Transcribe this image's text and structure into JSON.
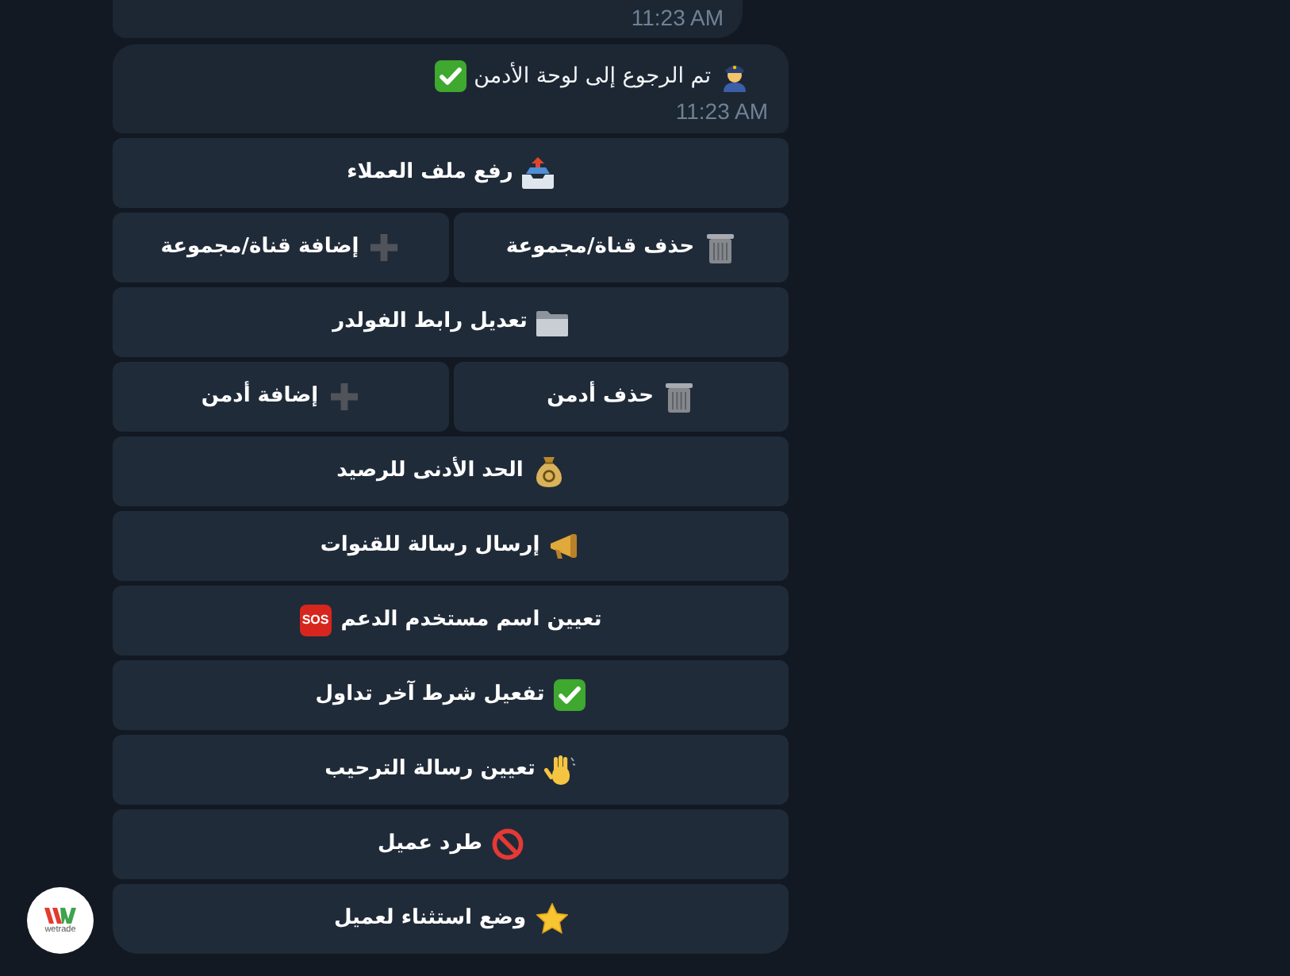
{
  "messages": [
    {
      "time": "11:23 AM"
    },
    {
      "text": "تم الرجوع إلى لوحة الأدمن",
      "time": "11:23 AM",
      "keyboard": [
        [
          {
            "label": "رفع ملف العملاء"
          }
        ],
        [
          {
            "label": "حذف قناة/مجموعة"
          },
          {
            "label": "إضافة قناة/مجموعة"
          }
        ],
        [
          {
            "label": "تعديل رابط الفولدر"
          }
        ],
        [
          {
            "label": "حذف أدمن"
          },
          {
            "label": "إضافة أدمن"
          }
        ],
        [
          {
            "label": "الحد الأدنى للرصيد"
          }
        ],
        [
          {
            "label": "إرسال رسالة للقنوات"
          }
        ],
        [
          {
            "label": "تعيين اسم مستخدم الدعم",
            "tag": "SOS"
          }
        ],
        [
          {
            "label": "تفعيل شرط آخر تداول"
          }
        ],
        [
          {
            "label": "تعيين رسالة الترحيب"
          }
        ],
        [
          {
            "label": "طرد عميل"
          }
        ],
        [
          {
            "label": "وضع استثناء لعميل"
          }
        ]
      ]
    }
  ],
  "avatar": {
    "logo_text": "wetrade"
  }
}
